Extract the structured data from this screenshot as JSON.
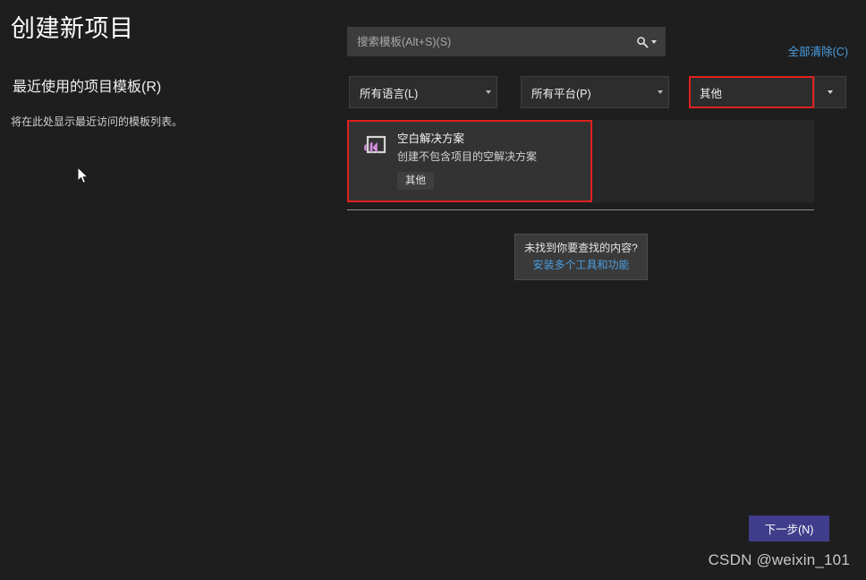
{
  "window": {
    "title": "创建新项目"
  },
  "left": {
    "title": "创建新项目",
    "recent_heading": "最近使用的项目模板(R)",
    "recent_empty_text": "将在此处显示最近访问的模板列表。"
  },
  "search": {
    "placeholder": "搜索模板(Alt+S)(S)",
    "value": "",
    "icon": "search-icon",
    "dropdown_icon": "chevron-down-icon"
  },
  "clear_all": {
    "label": "全部清除(C)"
  },
  "filters": [
    {
      "name": "language",
      "label": "所有语言(L)",
      "highlighted": false
    },
    {
      "name": "platform",
      "label": "所有平台(P)",
      "highlighted": false
    },
    {
      "name": "project_type",
      "label": "其他",
      "highlighted": true
    }
  ],
  "templates": [
    {
      "name": "空白解决方案",
      "description": "创建不包含项目的空解决方案",
      "tags": [
        "其他"
      ],
      "icon": "visual-studio-solution-icon",
      "selected": true
    }
  ],
  "not_found": {
    "text": "未找到你要查找的内容?",
    "link": "安装多个工具和功能"
  },
  "footer": {
    "next_label": "下一步(N)"
  },
  "watermark": {
    "text": "CSDN @weixin_101"
  },
  "colors": {
    "background": "#1e1e1e",
    "panel": "#272727",
    "item_selected": "#333333",
    "accent_link": "#4a9ee0",
    "primary_button": "#403d8c",
    "annotation_outline": "#e02020",
    "vs_logo_purple": "#d08bdd"
  }
}
